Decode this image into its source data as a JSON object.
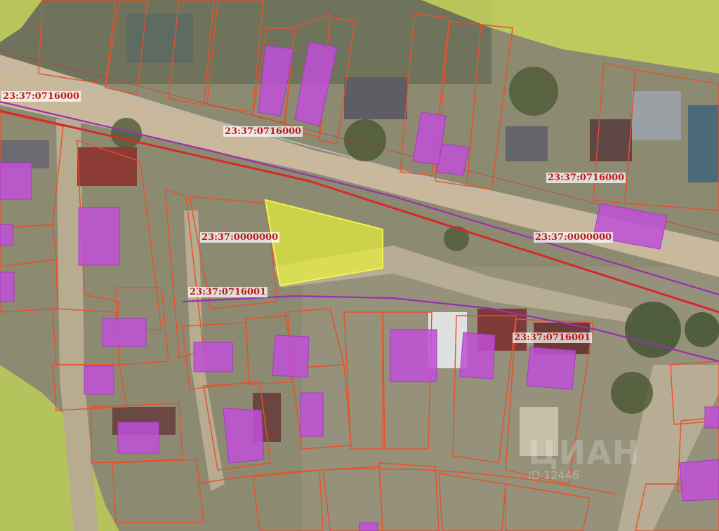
{
  "map": {
    "colors": {
      "land": "#8d8a72",
      "road": "#c9b89c",
      "parcel_border": "#e8502a",
      "road_line": "#d22b2b",
      "zone_line": "#9a2fb0",
      "building": "#c04fd8",
      "selected_parcel": "#e6ee3c",
      "green_zone": "#c7d35a",
      "label_text": "#b81c1c"
    },
    "labels": {
      "block_nw": "23:37:0716000",
      "block_n": "23:37:0716000",
      "block_ne": "23:37:0716000",
      "selected_parcel": "23:37:0000000",
      "road_east": "23:37:0000000",
      "block_s": "23:37:0716001",
      "block_se": "23:37:0716001"
    },
    "watermark": {
      "brand": "ЦИАН",
      "id": "ID 12446"
    },
    "overlay_types": {
      "selected_parcel": "highlighted-parcel",
      "buildings": "building-footprints",
      "parcels": "cadastral-parcel-borders",
      "zones": "zone-boundaries"
    }
  }
}
